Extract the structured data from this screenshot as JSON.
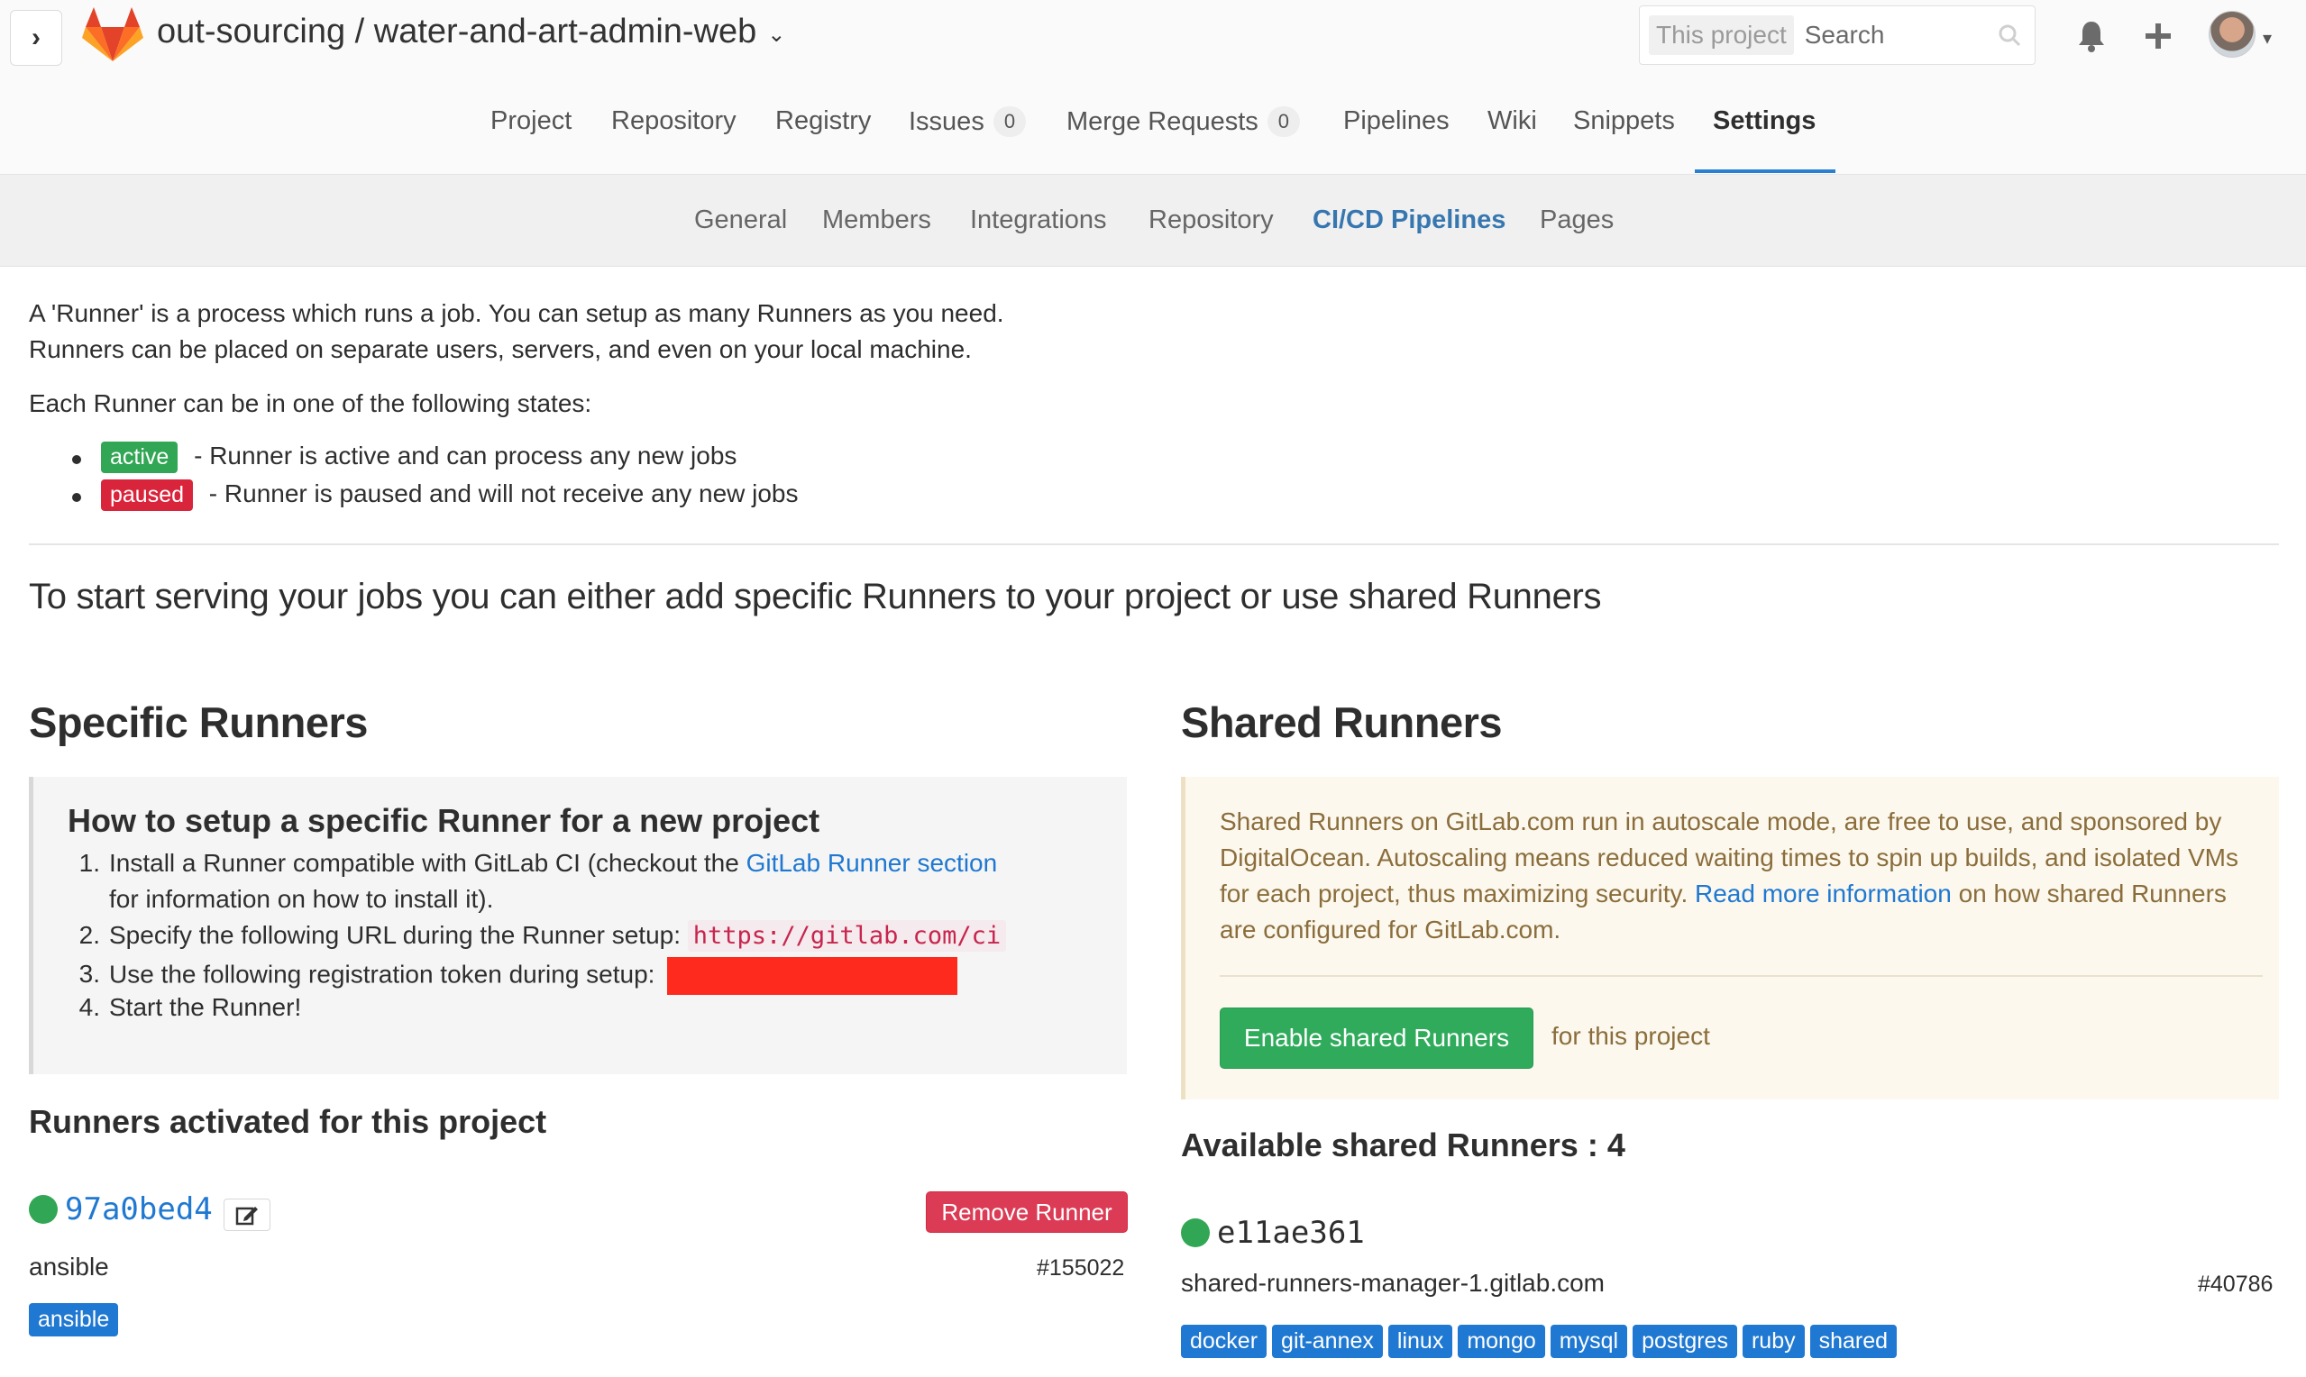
{
  "header": {
    "toggle_symbol": "›",
    "breadcrumb": "out-sourcing / water-and-art-admin-web",
    "breadcrumb_caret": "⌄",
    "search_scope": "This project",
    "search_placeholder": "Search",
    "colors": {
      "logo_orange": "#fc6d26",
      "logo_red": "#e24329"
    }
  },
  "main_nav": {
    "items": [
      {
        "label": "Project"
      },
      {
        "label": "Repository"
      },
      {
        "label": "Registry"
      },
      {
        "label": "Issues",
        "count": "0"
      },
      {
        "label": "Merge Requests",
        "count": "0"
      },
      {
        "label": "Pipelines"
      },
      {
        "label": "Wiki"
      },
      {
        "label": "Snippets"
      },
      {
        "label": "Settings",
        "active": true
      }
    ],
    "accent": "#2a80d0"
  },
  "sub_nav": {
    "items": [
      {
        "label": "General"
      },
      {
        "label": "Members"
      },
      {
        "label": "Integrations"
      },
      {
        "label": "Repository"
      },
      {
        "label": "CI/CD Pipelines",
        "active": true
      },
      {
        "label": "Pages"
      }
    ]
  },
  "intro": {
    "line1": "A 'Runner' is a process which runs a job. You can setup as many Runners as you need.",
    "line2": "Runners can be placed on separate users, servers, and even on your local machine.",
    "states_heading": "Each Runner can be in one of the following states:",
    "states": [
      {
        "label": "active",
        "text": " - Runner is active and can process any new jobs",
        "color": "#31a654"
      },
      {
        "label": "paused",
        "text": " - Runner is paused and will not receive any new jobs",
        "color": "#d9253c"
      }
    ],
    "lead": "To start serving your jobs you can either add specific Runners to your project or use shared Runners"
  },
  "specific": {
    "heading": "Specific Runners",
    "setup_title": "How to setup a specific Runner for a new project",
    "steps": {
      "s1_num": "1.",
      "s1_a": "Install a Runner compatible with GitLab CI (checkout the ",
      "s1_link": "GitLab Runner section",
      "s1_b": "for information on how to install it).",
      "s2_num": "2.",
      "s2_text": "Specify the following URL during the Runner setup: ",
      "s2_code": "https://gitlab.com/ci",
      "s3_num": "3.",
      "s3_text": "Use the following registration token during setup: ",
      "s4_num": "4.",
      "s4_text": "Start the Runner!"
    },
    "activated_heading": "Runners activated for this project",
    "runner": {
      "id": "97a0bed4",
      "description": "ansible",
      "number": "#155022",
      "remove_label": "Remove Runner",
      "tags": [
        "ansible"
      ]
    }
  },
  "shared": {
    "heading": "Shared Runners",
    "info_text": "Shared Runners on GitLab.com run in autoscale mode, are free to use, and sponsored by DigitalOcean. Autoscaling means reduced waiting times to spin up builds, and isolated VMs for each project, thus maximizing security. ",
    "info_link": "Read more information",
    "info_tail": " on how shared Runners are configured for GitLab.com.",
    "enable_label": "Enable shared Runners",
    "enable_suffix": "for this project",
    "available_heading": "Available shared Runners : 4",
    "runner": {
      "id": "e11ae361",
      "description": "shared-runners-manager-1.gitlab.com",
      "number": "#40786",
      "tags": [
        "docker",
        "git-annex",
        "linux",
        "mongo",
        "mysql",
        "postgres",
        "ruby",
        "shared"
      ]
    }
  }
}
